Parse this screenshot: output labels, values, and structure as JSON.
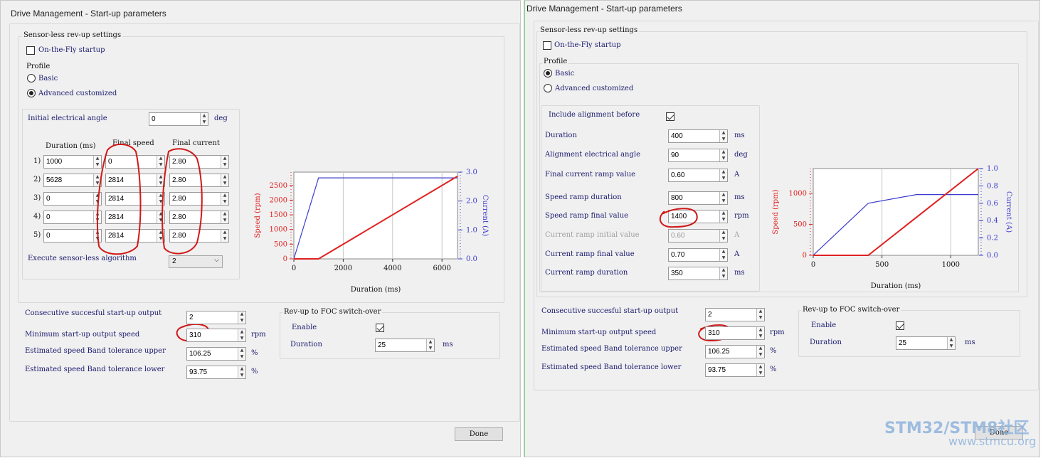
{
  "left": {
    "title": "Drive Management - Start-up parameters",
    "sensorless_title": "Sensor-less rev-up settings",
    "on_the_fly": "On-the-Fly startup",
    "profile": "Profile",
    "basic": "Basic",
    "advanced": "Advanced customized",
    "initial_angle_label": "Initial electrical angle",
    "initial_angle_value": "0",
    "initial_angle_unit": "deg",
    "col_duration": "Duration (ms)",
    "col_speed": "Final speed",
    "col_current": "Final current",
    "rows": [
      {
        "idx": "1)",
        "duration": "1000",
        "speed": "0",
        "current": "2.80"
      },
      {
        "idx": "2)",
        "duration": "5628",
        "speed": "2814",
        "current": "2.80"
      },
      {
        "idx": "3)",
        "duration": "0",
        "speed": "2814",
        "current": "2.80"
      },
      {
        "idx": "4)",
        "duration": "0",
        "speed": "2814",
        "current": "2.80"
      },
      {
        "idx": "5)",
        "duration": "0",
        "speed": "2814",
        "current": "2.80"
      }
    ],
    "execute_label": "Execute sensor-less algorithm",
    "execute_value": "2",
    "consecutive_label": "Consecutive succesful start-up output",
    "consecutive_value": "2",
    "min_speed_label": "Minimum start-up output speed",
    "min_speed_value": "310",
    "min_speed_unit": "rpm",
    "band_upper_label": "Estimated speed Band tolerance upper",
    "band_upper_value": "106.25",
    "band_lower_label": "Estimated speed Band tolerance lower",
    "band_lower_value": "93.75",
    "pct": "%",
    "foc_title": "Rev-up to FOC switch-over",
    "enable": "Enable",
    "duration": "Duration",
    "foc_duration_value": "25",
    "ms": "ms",
    "done": "Done",
    "chart": {
      "ylabel": "Speed (rpm)",
      "y2label": "Current (A)",
      "xlabel": "Duration (ms)",
      "yticks": [
        "0",
        "500",
        "1000",
        "1500",
        "2000",
        "2500"
      ],
      "y2ticks": [
        "0.0",
        "1.0",
        "2.0",
        "3.0"
      ],
      "xticks": [
        "0",
        "2000",
        "4000",
        "6000"
      ]
    }
  },
  "right": {
    "title": "Drive Management - Start-up parameters",
    "sensorless_title": "Sensor-less rev-up settings",
    "on_the_fly": "On-the-Fly startup",
    "profile": "Profile",
    "basic": "Basic",
    "advanced": "Advanced customized",
    "include_alignment": "Include alignment before",
    "fields": [
      {
        "label": "Duration",
        "value": "400",
        "unit": "ms"
      },
      {
        "label": "Alignment electrical angle",
        "value": "90",
        "unit": "deg"
      },
      {
        "label": "Final current ramp value",
        "value": "0.60",
        "unit": "A"
      },
      {
        "label": "Speed ramp duration",
        "value": "800",
        "unit": "ms"
      },
      {
        "label": "Speed ramp final value",
        "value": "1400",
        "unit": "rpm"
      },
      {
        "label": "Current ramp initial value",
        "value": "0.60",
        "unit": "A"
      },
      {
        "label": "Current ramp final value",
        "value": "0.70",
        "unit": "A"
      },
      {
        "label": "Current ramp duration",
        "value": "350",
        "unit": "ms"
      }
    ],
    "consecutive_label": "Consecutive succesful start-up output",
    "consecutive_value": "2",
    "min_speed_label": "Minimum start-up output speed",
    "min_speed_value": "310",
    "min_speed_unit": "rpm",
    "band_upper_label": "Estimated speed Band tolerance upper",
    "band_upper_value": "106.25",
    "band_lower_label": "Estimated speed Band tolerance lower",
    "band_lower_value": "93.75",
    "pct": "%",
    "foc_title": "Rev-up to FOC switch-over",
    "enable": "Enable",
    "duration": "Duration",
    "foc_duration_value": "25",
    "ms": "ms",
    "done": "Done",
    "chart": {
      "ylabel": "Speed (rpm)",
      "y2label": "Current (A)",
      "xlabel": "Duration (ms)",
      "yticks": [
        "0",
        "500",
        "1000"
      ],
      "y2ticks": [
        "0.0",
        "0.2",
        "0.4",
        "0.6",
        "0.8",
        "1.0"
      ],
      "xticks": [
        "0",
        "500",
        "1000"
      ]
    }
  },
  "watermark": {
    "line1a": "STM32/",
    "line1b": "STM8",
    "line1c": "社区",
    "line2": "www.stmcu.org"
  },
  "colors": {
    "speed": "#e02020",
    "current": "#3b3bcf",
    "annotation": "#d01818"
  },
  "chart_data": [
    {
      "type": "line",
      "xlabel": "Duration (ms)",
      "ylabel": "Speed (rpm)",
      "y2label": "Current (A)",
      "xlim": [
        0,
        6628
      ],
      "ylim": [
        0,
        2814
      ],
      "y2lim": [
        0,
        3.0
      ],
      "series": [
        {
          "x": [
            0,
            1000,
            6628
          ],
          "y": [
            0,
            0,
            2814
          ]
        },
        {
          "x": [
            0,
            1000,
            6628
          ],
          "y": [
            0,
            2.8,
            2.8
          ]
        }
      ]
    },
    {
      "type": "line",
      "xlabel": "Duration (ms)",
      "ylabel": "Speed (rpm)",
      "y2label": "Current (A)",
      "xlim": [
        0,
        1200
      ],
      "ylim": [
        0,
        1400
      ],
      "y2lim": [
        0,
        1.0
      ],
      "series": [
        {
          "x": [
            0,
            400,
            1200
          ],
          "y": [
            0,
            0,
            1400
          ]
        },
        {
          "x": [
            0,
            400,
            750,
            1200
          ],
          "y": [
            0,
            0.6,
            0.7,
            0.7
          ]
        }
      ]
    }
  ]
}
